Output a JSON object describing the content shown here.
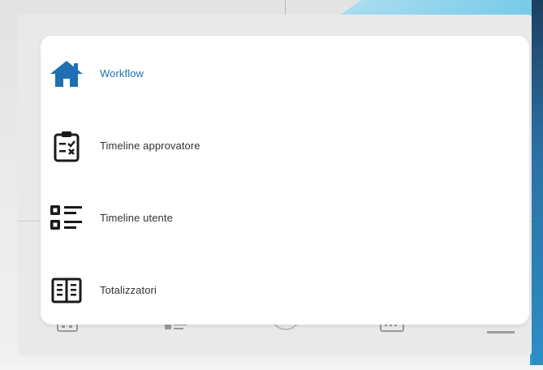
{
  "colors": {
    "active": "#1f6fb2",
    "text": "#333333",
    "icon": "#1a1a1a",
    "card": "#ffffff"
  },
  "menu": {
    "items": [
      {
        "label": "Workflow",
        "icon": "home-icon",
        "active": true
      },
      {
        "label": "Timeline approvatore",
        "icon": "clipboard-check-icon",
        "active": false
      },
      {
        "label": "Timeline utente",
        "icon": "checklist-icon",
        "active": false
      },
      {
        "label": "Totalizzatori",
        "icon": "table-icon",
        "active": false
      }
    ]
  },
  "bottom_nav": {
    "items": [
      {
        "icon": "calendar-icon"
      },
      {
        "icon": "checklist-icon"
      },
      {
        "icon": "circle-icon"
      },
      {
        "icon": "keyboard-icon"
      },
      {
        "icon": "menu-icon"
      }
    ]
  }
}
